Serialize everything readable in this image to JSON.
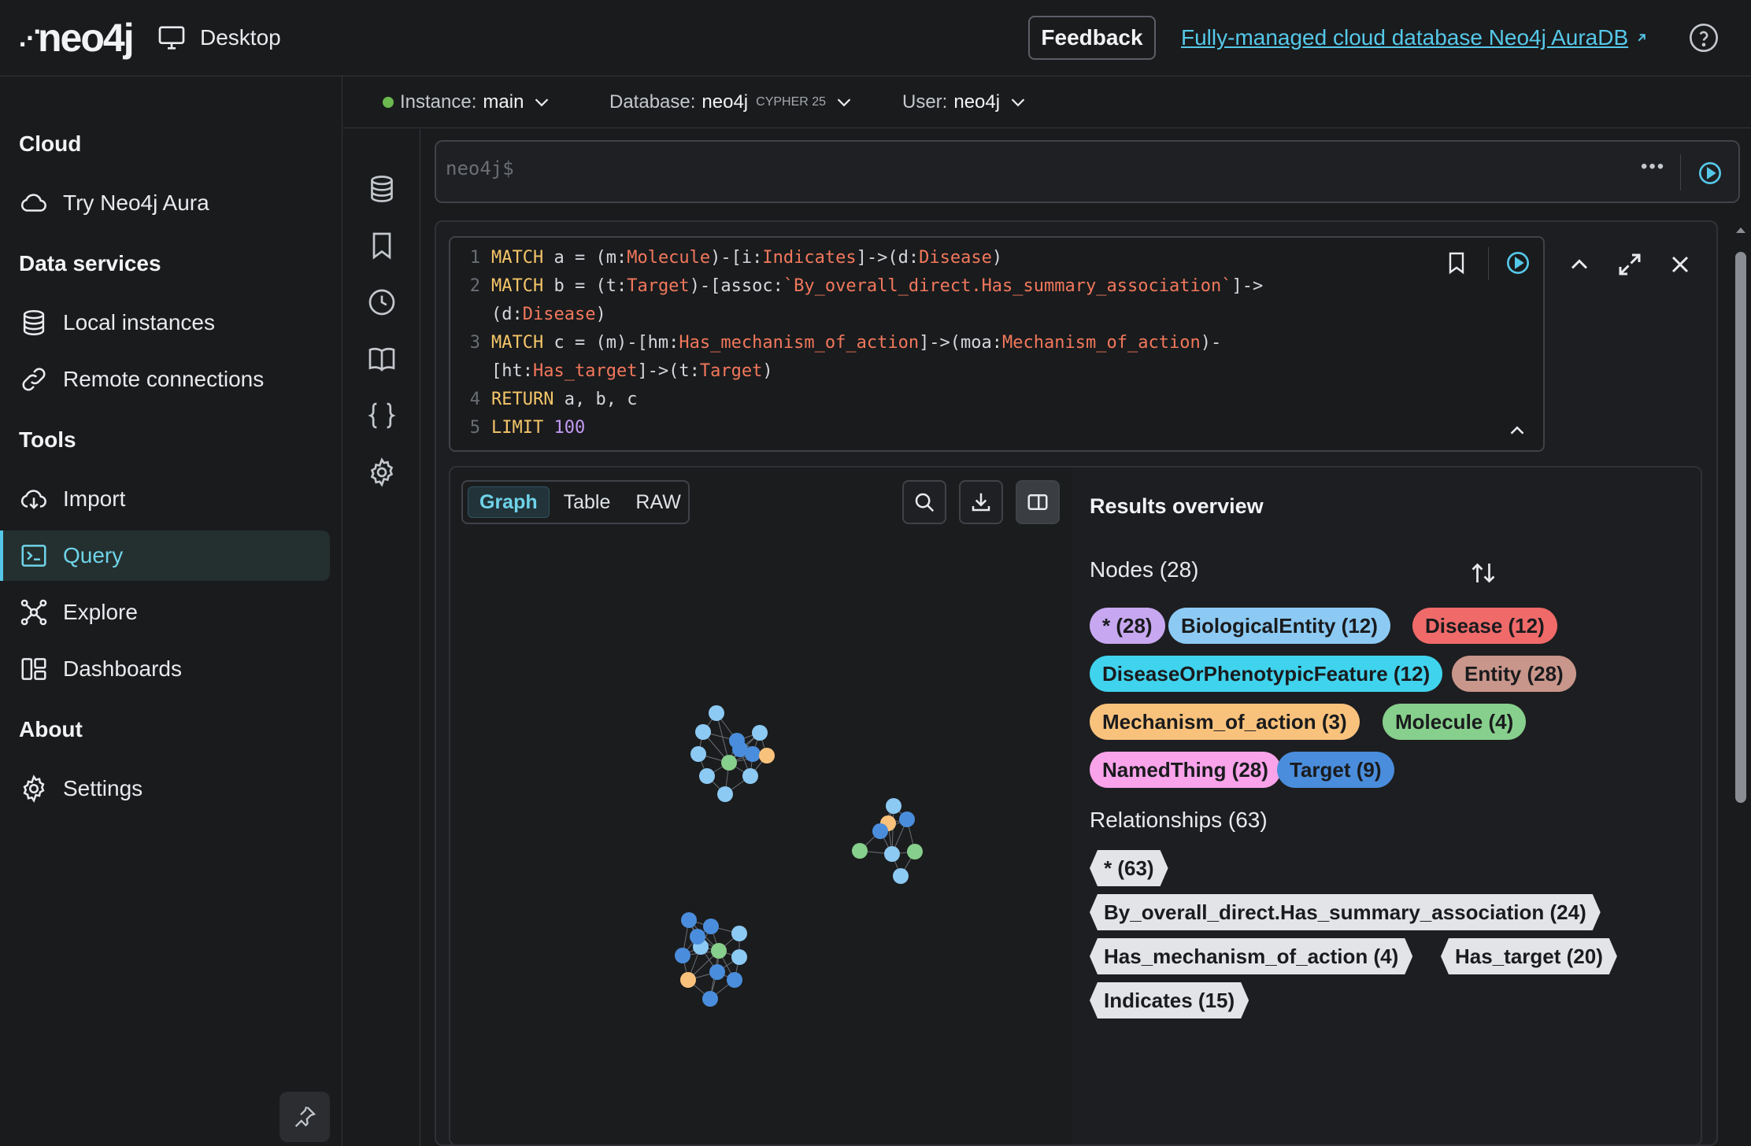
{
  "header": {
    "logo_text": "neo4j",
    "app_mode": "Desktop",
    "feedback_label": "Feedback",
    "aura_link": "Fully-managed cloud database Neo4j AuraDB"
  },
  "sidebar": {
    "sections": [
      {
        "heading": "Cloud",
        "items": [
          {
            "label": "Try Neo4j Aura",
            "icon": "cloud-icon"
          }
        ]
      },
      {
        "heading": "Data services",
        "items": [
          {
            "label": "Local instances",
            "icon": "database-icon"
          },
          {
            "label": "Remote connections",
            "icon": "link-icon"
          }
        ]
      },
      {
        "heading": "Tools",
        "items": [
          {
            "label": "Import",
            "icon": "cloud-upload-icon"
          },
          {
            "label": "Query",
            "icon": "terminal-icon",
            "active": true
          },
          {
            "label": "Explore",
            "icon": "graph-icon"
          },
          {
            "label": "Dashboards",
            "icon": "dashboard-icon"
          }
        ]
      },
      {
        "heading": "About",
        "items": [
          {
            "label": "Settings",
            "icon": "gear-icon"
          }
        ]
      }
    ]
  },
  "connection": {
    "instance_label": "Instance:",
    "instance_value": "main",
    "database_label": "Database:",
    "database_value": "neo4j",
    "cypher_version": "CYPHER 25",
    "user_label": "User:",
    "user_value": "neo4j",
    "status_color": "#6bb94f"
  },
  "editor": {
    "prompt": "neo4j$"
  },
  "query": {
    "line_numbers": [
      "1",
      "2",
      "3",
      "4",
      "5"
    ]
  },
  "viz": {
    "tabs": [
      "Graph",
      "Table",
      "RAW"
    ],
    "active_tab": "Graph"
  },
  "results": {
    "title": "Results overview",
    "nodes_heading": "Nodes (28)",
    "node_labels": [
      {
        "text": "* (28)",
        "color": "#c7a8f0"
      },
      {
        "text": "BiologicalEntity (12)",
        "color": "#8ccaf3"
      },
      {
        "text": "Disease (12)",
        "color": "#f06a6a"
      },
      {
        "text": "DiseaseOrPhenotypicFeature (12)",
        "color": "#3fd3ee"
      },
      {
        "text": "Entity (28)",
        "color": "#c9968b"
      },
      {
        "text": "Mechanism_of_action (3)",
        "color": "#f9c27c"
      },
      {
        "text": "Molecule (4)",
        "color": "#87cf8c"
      },
      {
        "text": "NamedThing (28)",
        "color": "#f8a3ea"
      },
      {
        "text": "Target (9)",
        "color": "#4a8ddc"
      }
    ],
    "relationships_heading": "Relationships (63)",
    "relationship_types": [
      "* (63)",
      "By_overall_direct.Has_summary_association (24)",
      "Has_mechanism_of_action (4)",
      "Has_target (20)",
      "Indicates (15)"
    ]
  }
}
